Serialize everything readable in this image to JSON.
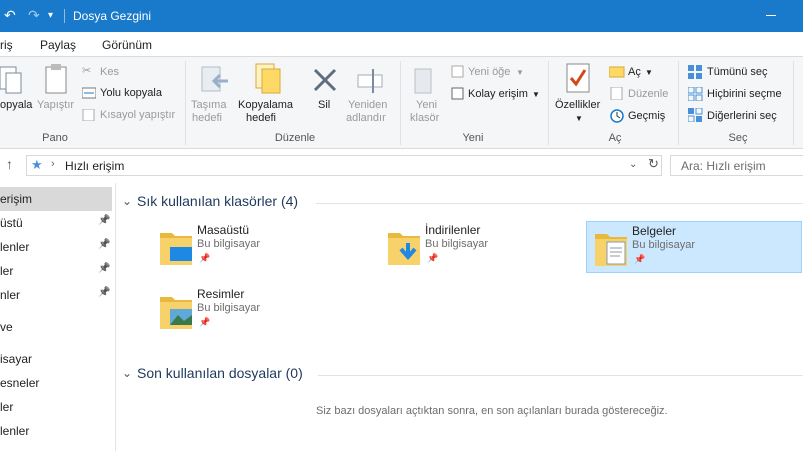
{
  "window": {
    "title": "Dosya Gezgini"
  },
  "ribbon_tabs": [
    "riş",
    "Paylaş",
    "Görünüm"
  ],
  "ribbon": {
    "pano": {
      "label": "Pano",
      "copy": "opyala",
      "paste": "Yapıştır",
      "cut": "Kes",
      "copy_path": "Yolu kopyala",
      "paste_shortcut": "Kısayol yapıştır"
    },
    "duzenle": {
      "label": "Düzenle",
      "move_to": [
        "Taşıma",
        "hedefi"
      ],
      "copy_to": [
        "Kopyalama",
        "hedefi"
      ],
      "delete": "Sil",
      "rename": [
        "Yeniden",
        "adlandır"
      ]
    },
    "yeni": {
      "label": "Yeni",
      "new_folder": [
        "Yeni",
        "klasör"
      ],
      "new_item": "Yeni öğe",
      "easy_access": "Kolay erişim"
    },
    "ac": {
      "label": "Aç",
      "properties": "Özellikler",
      "open": "Aç",
      "edit": "Düzenle",
      "history": "Geçmiş"
    },
    "sec": {
      "label": "Seç",
      "select_all": "Tümünü seç",
      "select_none": "Hiçbirini seçme",
      "invert": "Diğerlerini seç"
    }
  },
  "address": {
    "path": "Hızlı erişim",
    "search_placeholder": "Ara: Hızlı erişim"
  },
  "nav": {
    "items": [
      {
        "label": "erişim",
        "pinned": false,
        "selected": true
      },
      {
        "label": "üstü",
        "pinned": true
      },
      {
        "label": "lenler",
        "pinned": true
      },
      {
        "label": "ler",
        "pinned": true
      },
      {
        "label": "nler",
        "pinned": true
      },
      {
        "label": "ve",
        "pinned": false
      },
      {
        "label": "isayar",
        "pinned": false
      },
      {
        "label": "esneler",
        "pinned": false
      },
      {
        "label": "ler",
        "pinned": false
      },
      {
        "label": "lenler",
        "pinned": false
      }
    ]
  },
  "frequent": {
    "header": "Sık kullanılan klasörler (4)",
    "folders": [
      {
        "name": "Masaüstü",
        "location": "Bu bilgisayar",
        "icon": "desktop-folder-icon"
      },
      {
        "name": "İndirilenler",
        "location": "Bu bilgisayar",
        "icon": "downloads-folder-icon"
      },
      {
        "name": "Belgeler",
        "location": "Bu bilgisayar",
        "icon": "documents-folder-icon",
        "selected": true
      },
      {
        "name": "Resimler",
        "location": "Bu bilgisayar",
        "icon": "pictures-folder-icon"
      }
    ]
  },
  "recent": {
    "header": "Son kullanılan dosyalar (0)",
    "empty_text": "Siz bazı dosyaları açtıktan sonra, en son açılanları burada göstereceğiz."
  },
  "colors": {
    "titlebar": "#1979ca",
    "selection": "#cce8ff",
    "heading": "#1e395b"
  }
}
